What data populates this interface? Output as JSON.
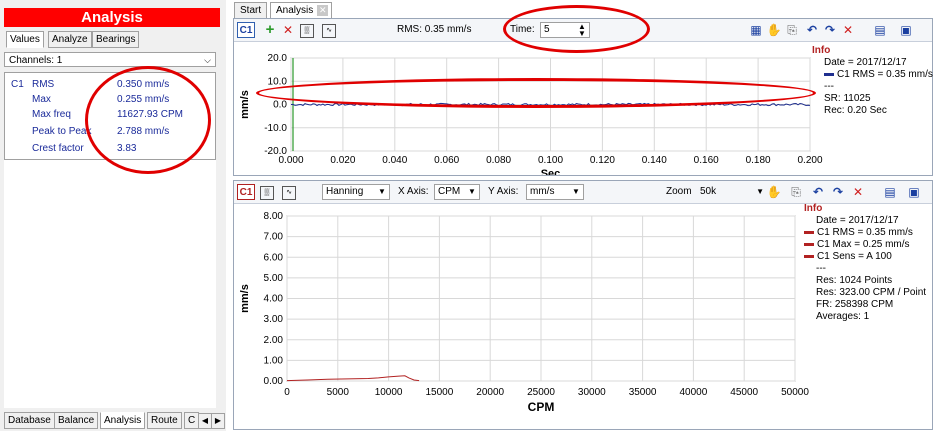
{
  "left_panel": {
    "title": "Analysis",
    "tabs": [
      "Values",
      "Analyze",
      "Bearings"
    ],
    "channel_select": "Channels: 1",
    "channel_tag": "C1",
    "values": [
      {
        "label": "RMS",
        "value": "0.350 mm/s"
      },
      {
        "label": "Max",
        "value": "0.255 mm/s"
      },
      {
        "label": "Max freq",
        "value": "11627.93 CPM"
      },
      {
        "label": "Peak to Peak",
        "value": "2.788 mm/s"
      },
      {
        "label": "Crest factor",
        "value": "3.83"
      }
    ],
    "bottom_tabs": [
      "Database",
      "Balance",
      "Analysis",
      "Route",
      "C"
    ]
  },
  "doc_tabs": [
    "Start",
    "Analysis"
  ],
  "time_panel": {
    "tag": "C1",
    "rms_label": "RMS: 0.35 mm/s",
    "time_label": "Time:",
    "time_value": "5",
    "info": {
      "title": "Info",
      "date": "Date = 2017/12/17",
      "legend": "C1 RMS = 0.35 mm/s",
      "sep": "---",
      "sr": "SR: 11025",
      "rec": "Rec: 0.20 Sec"
    }
  },
  "spectrum_panel": {
    "tag": "C1",
    "window": "Hanning",
    "xaxis_label": "X Axis:",
    "xaxis_value": "CPM",
    "yaxis_label": "Y Axis:",
    "yaxis_value": "mm/s",
    "zoom_label": "Zoom",
    "zoom_value": "50k",
    "info": {
      "title": "Info",
      "date": "Date = 2017/12/17",
      "legend": [
        "C1 RMS = 0.35 mm/s",
        "C1 Max = 0.25 mm/s",
        "C1 Sens = A 100"
      ],
      "sep": "---",
      "res1": "Res: 1024 Points",
      "res2": "Res: 323.00 CPM / Point",
      "fr": "FR: 258398 CPM",
      "avg": "Averages: 1"
    }
  },
  "colors": {
    "series": "#1f2f8f",
    "spectrum": "#b22222",
    "accent": "#ff0000"
  },
  "chart_data": [
    {
      "type": "line",
      "xlabel": "Sec",
      "ylabel": "mm/s",
      "xlim": [
        0,
        0.2
      ],
      "ylim": [
        -20,
        20
      ],
      "x_ticks": [
        "0.000",
        "0.020",
        "0.040",
        "0.060",
        "0.080",
        "0.100",
        "0.120",
        "0.140",
        "0.160",
        "0.180",
        "0.200"
      ],
      "y_ticks": [
        "20.0",
        "10.0",
        "0.0",
        "-10.0",
        "-20.0"
      ],
      "series": [
        {
          "values_range": [
            -1,
            1
          ]
        }
      ]
    },
    {
      "type": "line",
      "xlabel": "CPM",
      "ylabel": "mm/s",
      "xlim": [
        0,
        50000
      ],
      "ylim": [
        0,
        8
      ],
      "x_ticks": [
        "0",
        "5000",
        "10000",
        "15000",
        "20000",
        "25000",
        "30000",
        "35000",
        "40000",
        "45000",
        "50000"
      ],
      "y_ticks": [
        "8.00",
        "7.00",
        "6.00",
        "5.00",
        "4.00",
        "3.00",
        "2.00",
        "1.00",
        "0.00"
      ],
      "series": [
        {
          "x": [
            0,
            2000,
            4000,
            6000,
            8000,
            9000,
            10000,
            11000,
            11600,
            12000,
            12500,
            13000
          ],
          "y": [
            0.02,
            0.05,
            0.08,
            0.1,
            0.12,
            0.15,
            0.2,
            0.24,
            0.25,
            0.15,
            0.05,
            0.02
          ]
        }
      ]
    }
  ]
}
